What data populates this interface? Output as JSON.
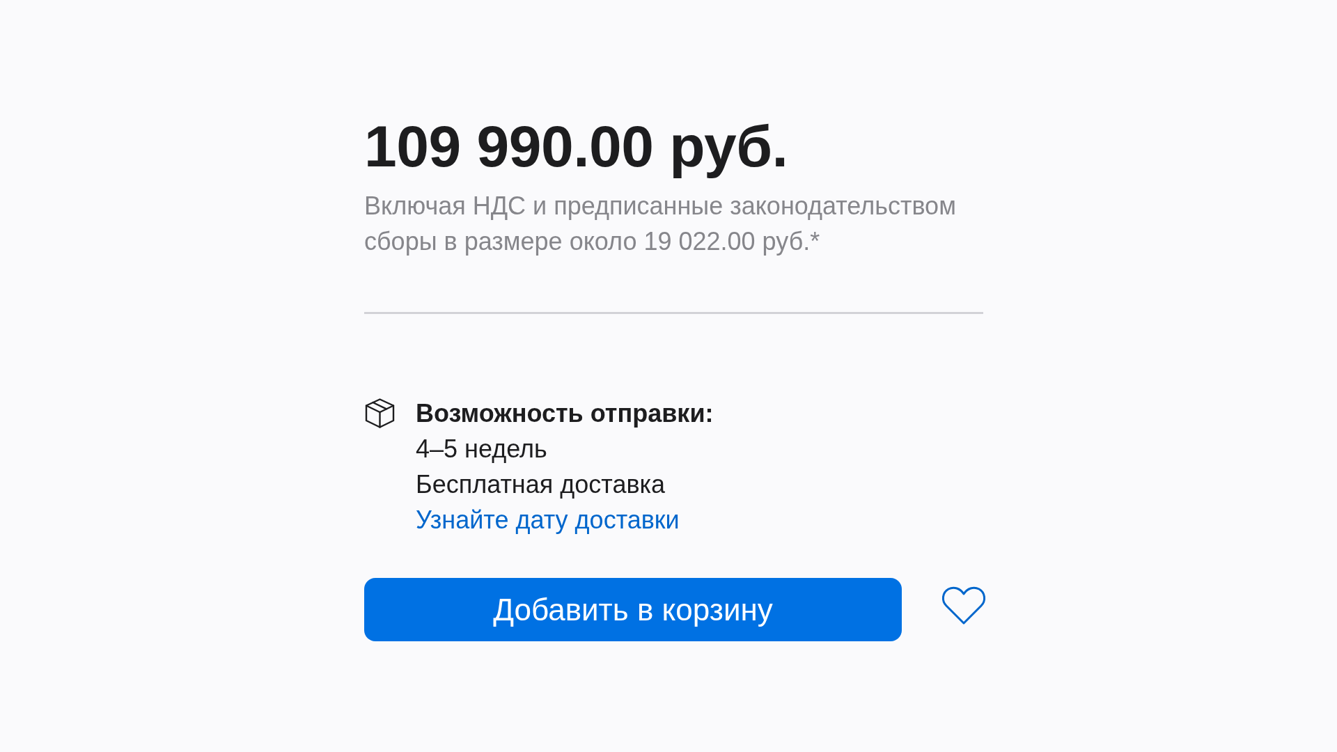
{
  "price": "109 990.00 руб.",
  "tax_note": "Включая НДС и предписанные законодательством сборы в размере около 19 022.00 руб.*",
  "shipping": {
    "heading": "Возможность отправки:",
    "lines": [
      "4–5 недель",
      "Бесплатная доставка"
    ],
    "link": "Узнайте дату доставки"
  },
  "add_to_cart_button": "Добавить в корзину",
  "wishlist": {
    "selected": false
  }
}
